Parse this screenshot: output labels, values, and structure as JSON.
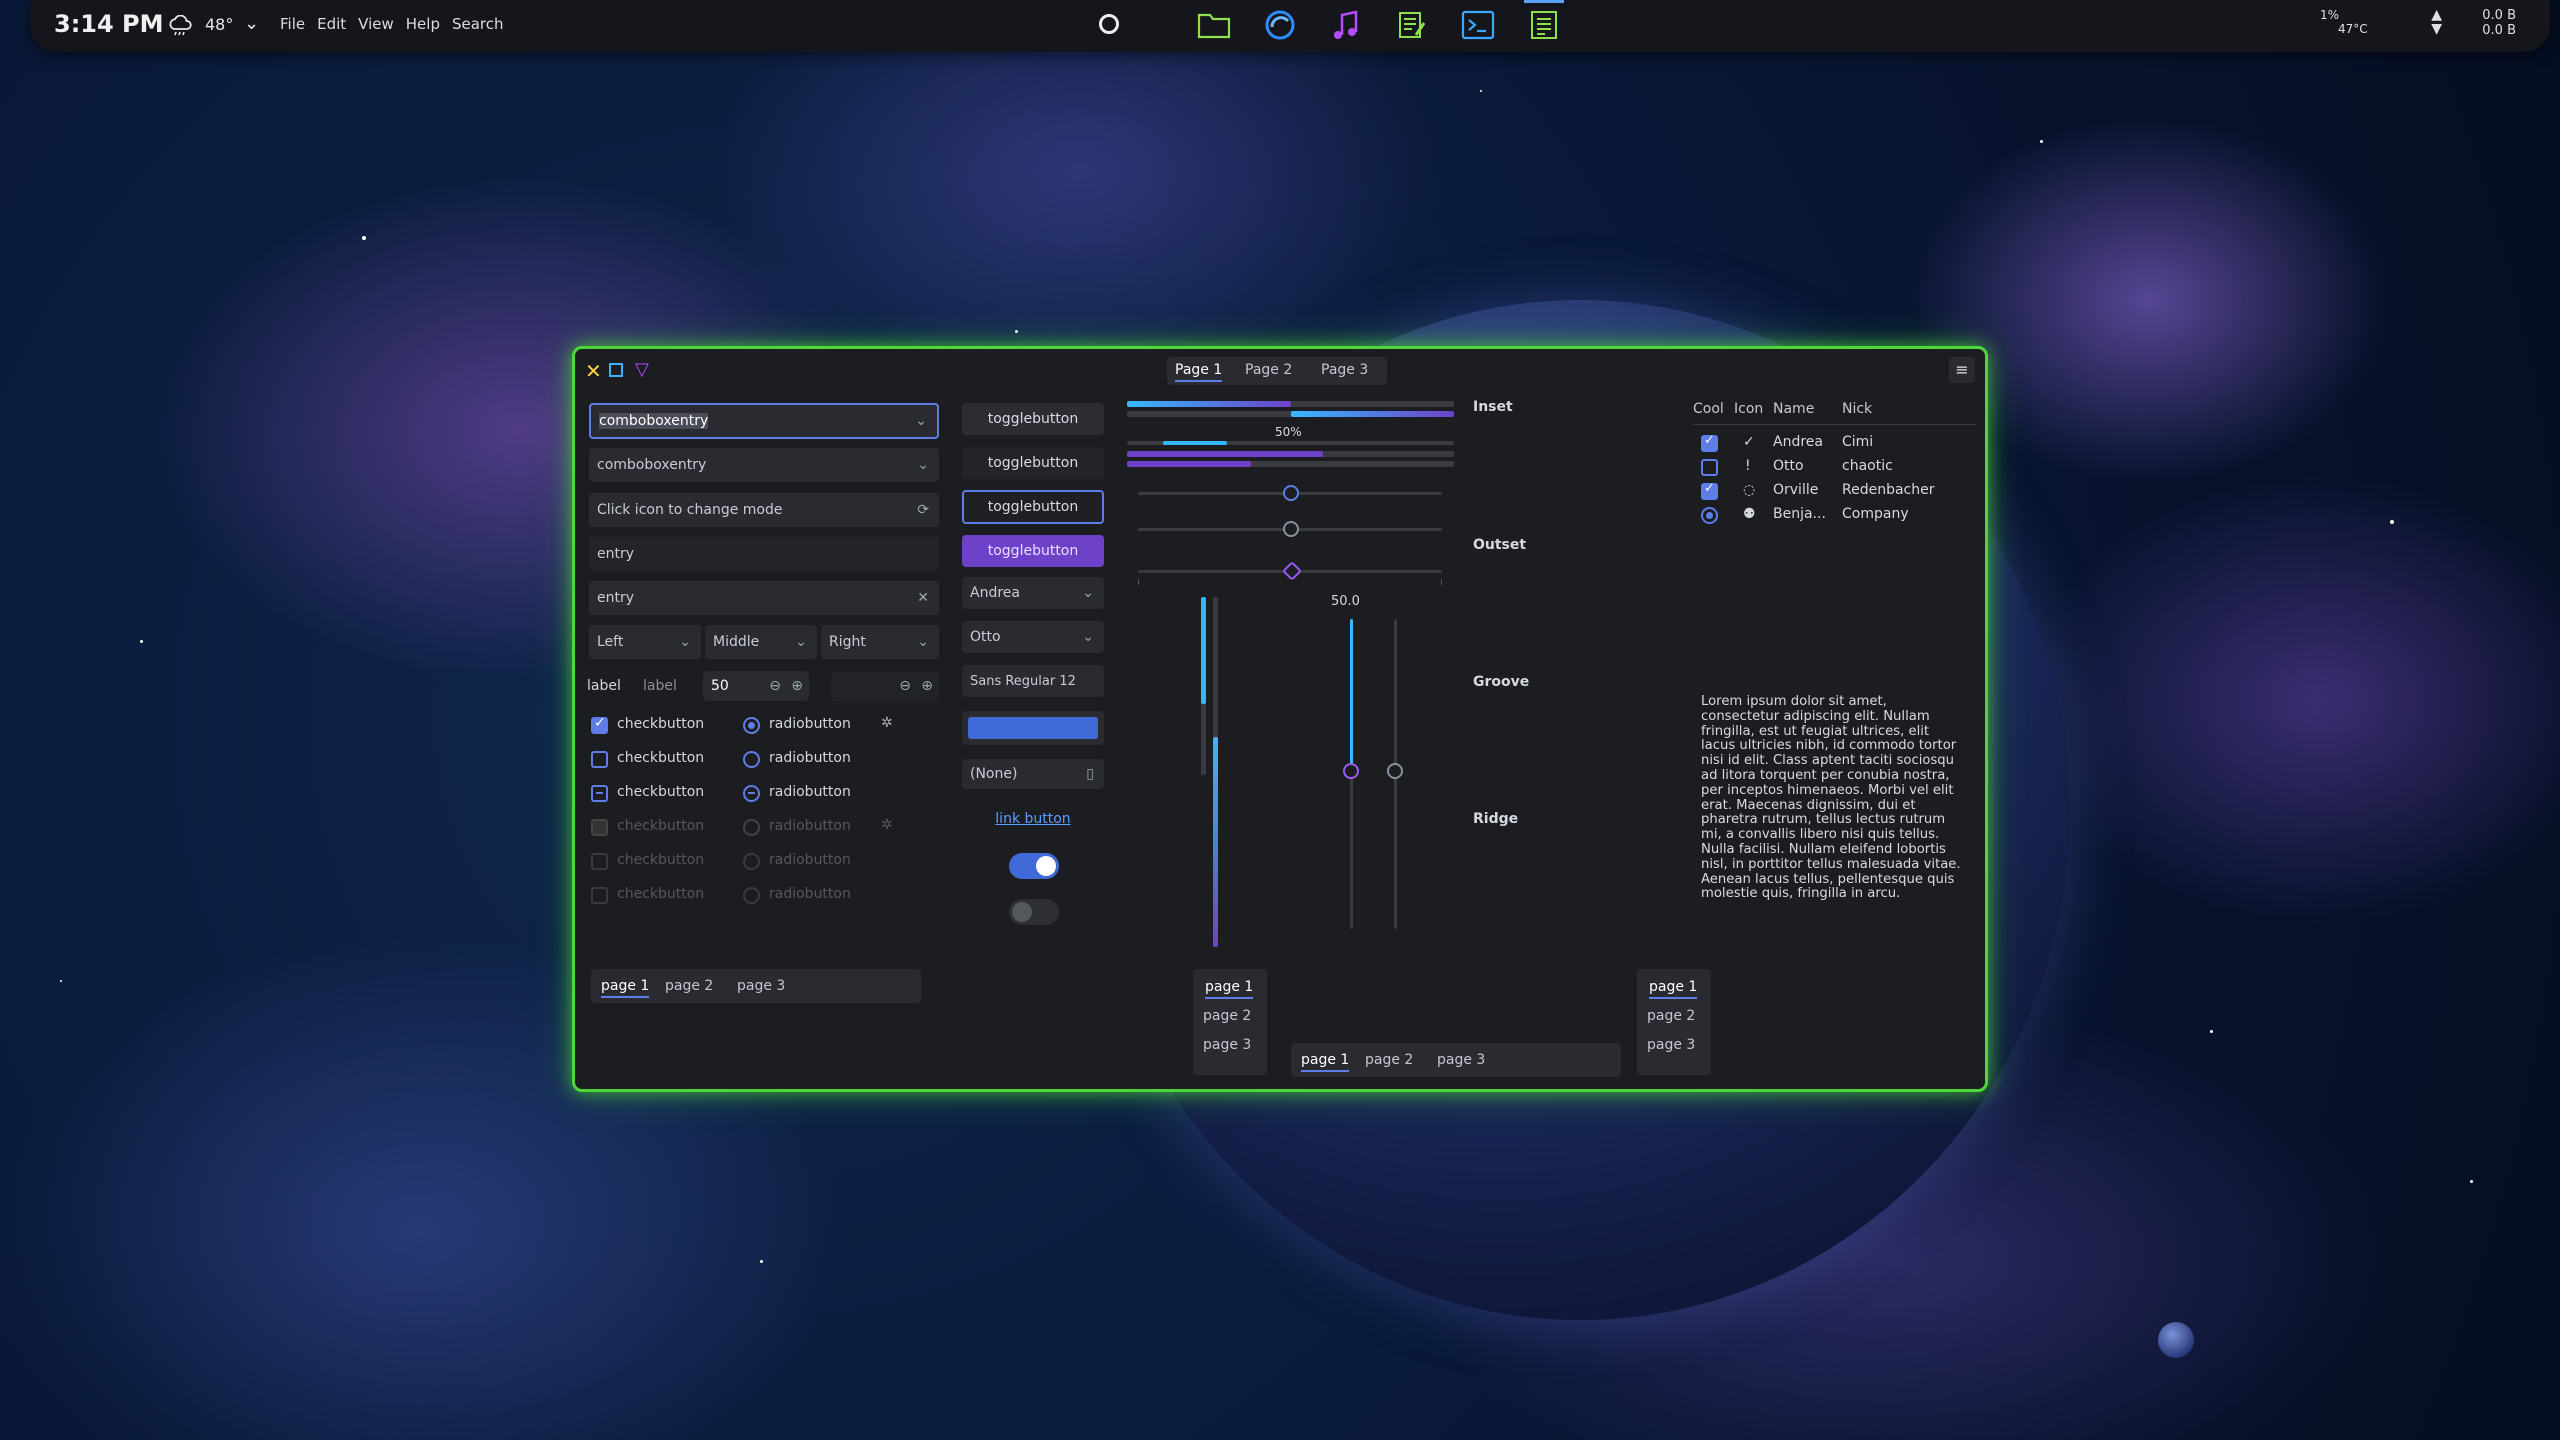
{
  "topbar": {
    "time": "3:14 PM",
    "temperature": "48°",
    "menu": [
      "File",
      "Edit",
      "View",
      "Help",
      "Search"
    ],
    "cpu_percent": "1%",
    "cpu_temp": "47°C",
    "net_up": "0.0 B",
    "net_down": "0.0 B",
    "dock_icons": [
      "folder-icon",
      "browser-icon",
      "music-icon",
      "notes-icon",
      "terminal-icon",
      "tasks-icon"
    ]
  },
  "window": {
    "tabs": [
      "Page 1",
      "Page 2",
      "Page 3"
    ],
    "combo1": "comboboxentry",
    "combo2": "comboboxentry",
    "mode_entry": "Click icon to change mode",
    "entry1": "entry",
    "entry2": "entry",
    "align": [
      "Left",
      "Middle",
      "Right"
    ],
    "label1": "label",
    "label2": "label",
    "spin_value": "50",
    "checks": [
      "checkbutton",
      "checkbutton",
      "checkbutton",
      "checkbutton",
      "checkbutton",
      "checkbutton"
    ],
    "radios": [
      "radiobutton",
      "radiobutton",
      "radiobutton",
      "radiobutton",
      "radiobutton",
      "radiobutton"
    ],
    "toggles": [
      "togglebutton",
      "togglebutton",
      "togglebutton",
      "togglebutton"
    ],
    "combo_andrea": "Andrea",
    "combo_otto": "Otto",
    "font_button": "Sans Regular  12",
    "file_none": "(None)",
    "link": "link button",
    "progress_label": "50%",
    "scale_value": "50.0",
    "frames": [
      "Inset",
      "Outset",
      "Groove",
      "Ridge"
    ],
    "tree": {
      "headers": [
        "Cool",
        "Icon",
        "Name",
        "Nick"
      ],
      "rows": [
        {
          "name": "Andrea",
          "nick": "Cimi",
          "icon": "✓"
        },
        {
          "name": "Otto",
          "nick": "chaotic",
          "icon": "!"
        },
        {
          "name": "Orville",
          "nick": "Redenbacher",
          "icon": "◌"
        },
        {
          "name": "Benja...",
          "nick": "Company",
          "icon": "⚉"
        }
      ]
    },
    "lorem": "Lorem ipsum dolor sit amet, consectetur adipiscing elit. Nullam fringilla, est ut feugiat ultrices, elit lacus ultricies nibh, id commodo tortor nisi id elit. Class aptent taciti sociosqu ad litora torquent per conubia nostra, per inceptos himenaeos. Morbi vel elit erat. Maecenas dignissim, dui et pharetra rutrum, tellus lectus rutrum mi, a convallis libero nisi quis tellus. Nulla facilisi. Nullam eleifend lobortis nisl, in porttitor tellus malesuada vitae. Aenean lacus tellus, pellentesque quis molestie quis, fringilla in arcu.",
    "bottom_tabs": [
      "page 1",
      "page 2",
      "page 3"
    ],
    "progress_values": {
      "bar1": 0.5,
      "bar2": 0.72,
      "bar3": 0.5
    }
  }
}
